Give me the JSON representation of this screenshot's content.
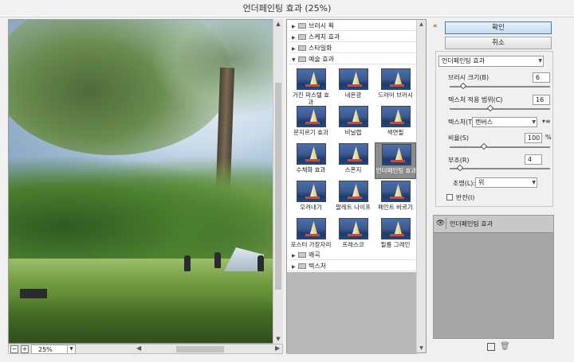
{
  "window": {
    "title": "언더페인팅 효과 (25%)"
  },
  "preview": {
    "zoom": "25%"
  },
  "gallery": {
    "categories": [
      {
        "label": "브러시 획",
        "expanded": false
      },
      {
        "label": "스케치 효과",
        "expanded": false
      },
      {
        "label": "스타일화",
        "expanded": false
      },
      {
        "label": "예술 효과",
        "expanded": true
      },
      {
        "label": "왜곡",
        "expanded": false
      },
      {
        "label": "텍스처",
        "expanded": false
      }
    ],
    "filters": [
      {
        "label": "거친 파스텔 효과"
      },
      {
        "label": "네온광"
      },
      {
        "label": "드라이 브러시"
      },
      {
        "label": "문지르기 효과"
      },
      {
        "label": "비닐랩"
      },
      {
        "label": "색연필"
      },
      {
        "label": "수채화 효과"
      },
      {
        "label": "스폰지"
      },
      {
        "label": "언더페인팅 효과",
        "selected": true
      },
      {
        "label": "오려내기"
      },
      {
        "label": "팔레트 나이프"
      },
      {
        "label": "페인트 바르기"
      },
      {
        "label": "포스터 가장자리"
      },
      {
        "label": "프레스코"
      },
      {
        "label": "필름 그레인"
      }
    ]
  },
  "actions": {
    "ok": "확인",
    "cancel": "취소"
  },
  "settings": {
    "filter": "언더페인팅 효과",
    "brush_size": {
      "label": "브러시 크기(B)",
      "value": "6",
      "fraction": 0.12
    },
    "texture_coverage": {
      "label": "텍스처 적용 범위(C)",
      "value": "16",
      "fraction": 0.4
    },
    "texture": {
      "label": "텍스처(T):",
      "value": "캔버스"
    },
    "scaling": {
      "label": "비율(S)",
      "value": "100",
      "unit": "%",
      "fraction": 0.33
    },
    "relief": {
      "label": "부조(R)",
      "value": "4",
      "fraction": 0.08
    },
    "light": {
      "label": "조명(L):",
      "value": "위"
    },
    "invert": {
      "label": "반전(I)",
      "checked": false
    }
  },
  "layers": [
    {
      "label": "언더페인팅 효과",
      "visible": true
    }
  ]
}
